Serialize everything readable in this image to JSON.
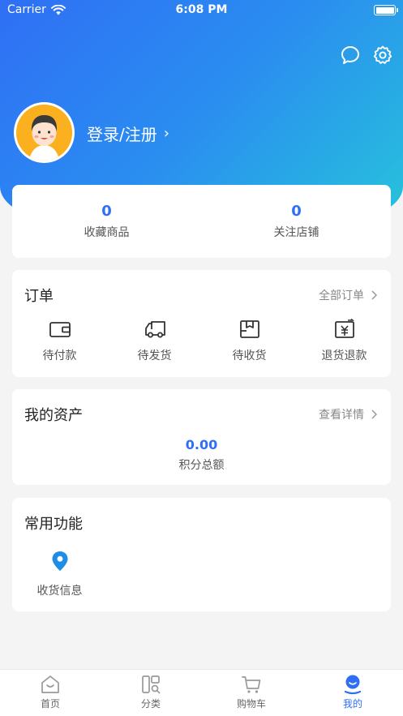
{
  "status_bar": {
    "carrier": "Carrier",
    "time": "6:08 PM"
  },
  "profile": {
    "login_label": "登录/注册",
    "chevron": "›"
  },
  "stats": [
    {
      "value": "0",
      "label": "收藏商品"
    },
    {
      "value": "0",
      "label": "关注店铺"
    }
  ],
  "orders": {
    "title": "订单",
    "more_label": "全部订单",
    "items": [
      {
        "label": "待付款",
        "icon": "wallet-icon"
      },
      {
        "label": "待发货",
        "icon": "truck-icon"
      },
      {
        "label": "待收货",
        "icon": "package-icon"
      },
      {
        "label": "退货退款",
        "icon": "refund-icon"
      }
    ]
  },
  "assets": {
    "title": "我的资产",
    "more_label": "查看详情",
    "points_value": "0.00",
    "points_label": "积分总额"
  },
  "functions": {
    "title": "常用功能",
    "items": [
      {
        "label": "收货信息",
        "icon": "location-pin-icon"
      }
    ]
  },
  "tabbar": [
    {
      "label": "首页",
      "icon": "home-icon",
      "active": false
    },
    {
      "label": "分类",
      "icon": "category-icon",
      "active": false
    },
    {
      "label": "购物车",
      "icon": "cart-icon",
      "active": false
    },
    {
      "label": "我的",
      "icon": "user-icon",
      "active": true
    }
  ],
  "colors": {
    "accent": "#2f6ff5",
    "gradient_start": "#2f6ff5",
    "gradient_end": "#27c2dc",
    "avatar_bg": "#fbb11f"
  }
}
